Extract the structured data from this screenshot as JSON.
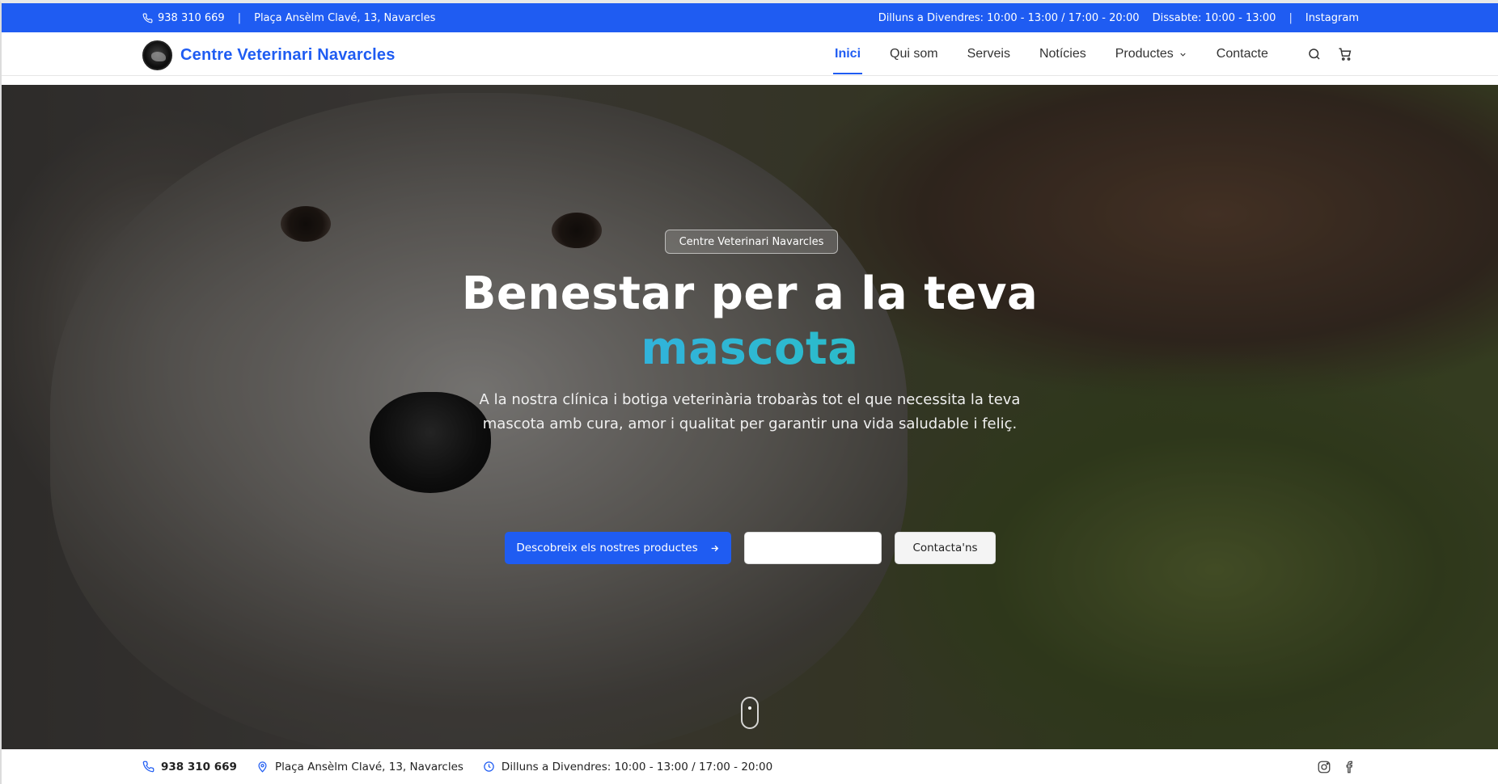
{
  "colors": {
    "primary": "#1f5cf2",
    "accent_start": "#3aa6f5",
    "accent_end": "#22c9b0"
  },
  "topbar": {
    "phone": "938 310 669",
    "address": "Plaça Ansèlm Clavé, 13, Navarcles",
    "hours_weekdays": "Dilluns a Divendres: 10:00 - 13:00 / 17:00 - 20:00",
    "hours_saturday": "Dissabte: 10:00 - 13:00",
    "instagram": "Instagram",
    "separator": "|"
  },
  "navbar": {
    "brand": "Centre Veterinari Navarcles",
    "items": [
      {
        "label": "Inici",
        "active": true
      },
      {
        "label": "Qui som"
      },
      {
        "label": "Serveis"
      },
      {
        "label": "Notícies"
      },
      {
        "label": "Productes",
        "dropdown": true
      },
      {
        "label": "Contacte"
      }
    ],
    "icons": [
      "search-icon",
      "cart-icon"
    ]
  },
  "hero": {
    "badge": "Centre Veterinari Navarcles",
    "headline": "Benestar per a la teva",
    "headline_accent": "mascota",
    "lead": "A la nostra clínica i botiga veterinària trobaràs tot el que necessita la teva mascota amb cura, amor i qualitat per garantir una vida saludable i feliç.",
    "cta_primary": "Descobreix els nostres productes",
    "cta_secondary": "Contacta'ns"
  },
  "infobar": {
    "phone": "938 310 669",
    "address": "Plaça Ansèlm Clavé, 13, Navarcles",
    "hours": "Dilluns a Divendres: 10:00 - 13:00 / 17:00 - 20:00",
    "social_icons": [
      "instagram-icon",
      "facebook-icon"
    ]
  }
}
